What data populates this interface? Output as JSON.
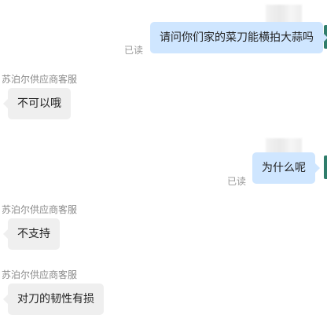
{
  "messages": [
    {
      "direction": "out",
      "text": "请问你们家的菜刀能横拍大蒜吗",
      "read_status": "已读"
    },
    {
      "direction": "in",
      "sender": "苏泊尔供应商客服",
      "text": "不可以哦"
    },
    {
      "direction": "out",
      "text": "为什么呢",
      "read_status": "已读"
    },
    {
      "direction": "in",
      "sender": "苏泊尔供应商客服",
      "text": "不支持"
    },
    {
      "direction": "in",
      "sender": "苏泊尔供应商客服",
      "text": "对刀的韧性有损"
    }
  ],
  "colors": {
    "outgoing_bubble": "#cfe6ff",
    "incoming_bubble": "#efefef",
    "meta_text": "#9a9a9a",
    "edge_accent": "#2f7d6b"
  }
}
